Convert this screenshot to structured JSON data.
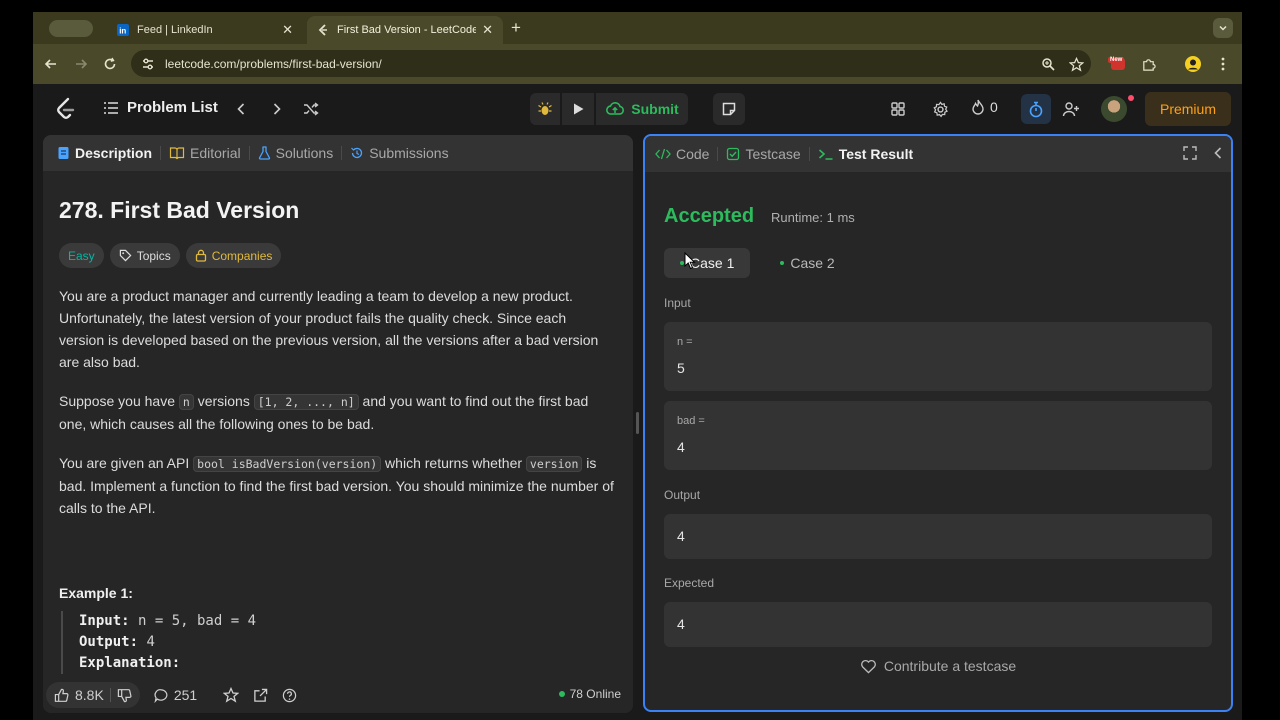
{
  "browser": {
    "tabs": [
      {
        "title": "Feed | LinkedIn",
        "active": false
      },
      {
        "title": "First Bad Version - LeetCode",
        "active": true
      }
    ],
    "url": "leetcode.com/problems/first-bad-version/",
    "badge": "New"
  },
  "header": {
    "problem_list_label": "Problem List",
    "submit_label": "Submit",
    "streak_count": "0",
    "premium_label": "Premium"
  },
  "left": {
    "tabs": [
      "Description",
      "Editorial",
      "Solutions",
      "Submissions"
    ],
    "title": "278. First Bad Version",
    "chips": {
      "difficulty": "Easy",
      "topics": "Topics",
      "companies": "Companies"
    },
    "p1": "You are a product manager and currently leading a team to develop a new product. Unfortunately, the latest version of your product fails the quality check. Since each version is developed based on the previous version, all the versions after a bad version are also bad.",
    "p2": {
      "a": "Suppose you have ",
      "code1": "n",
      "b": " versions ",
      "code2": "[1, 2, ..., n]",
      "c": " and you want to find out the first bad one, which causes all the following ones to be bad."
    },
    "p3": {
      "a": "You are given an API ",
      "code1": "bool isBadVersion(version)",
      "b": " which returns whether ",
      "code2": "version",
      "c": " is bad. Implement a function to find the first bad version. You should minimize the number of calls to the API."
    },
    "example_title": "Example 1:",
    "example": {
      "input_label": "Input:",
      "input_value": " n = 5, bad = 4",
      "output_label": "Output:",
      "output_value": " 4",
      "explanation_label": "Explanation:"
    },
    "footer": {
      "likes": "8.8K",
      "comments": "251",
      "online": "78 Online"
    }
  },
  "right": {
    "tabs": [
      "Code",
      "Testcase",
      "Test Result"
    ],
    "status": "Accepted",
    "runtime": "Runtime: 1 ms",
    "cases": [
      "Case 1",
      "Case 2"
    ],
    "input_label": "Input",
    "inputs": [
      {
        "name": "n =",
        "value": "5"
      },
      {
        "name": "bad =",
        "value": "4"
      }
    ],
    "output_label": "Output",
    "output_value": "4",
    "expected_label": "Expected",
    "expected_value": "4",
    "contribute_label": "Contribute a testcase"
  },
  "colors": {
    "accepted": "#2cbb5d",
    "easy": "#00b8a3",
    "premium": "#ffa116",
    "focus_border": "#3b82f6"
  }
}
